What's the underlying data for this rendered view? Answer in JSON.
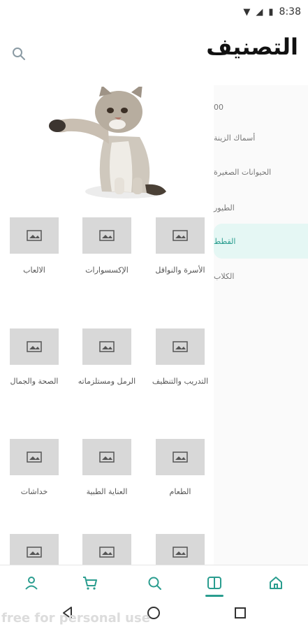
{
  "status_bar": {
    "time": "8:38"
  },
  "header": {
    "title": "التصنيف"
  },
  "sidebar": {
    "items": [
      {
        "label": "00",
        "active": false
      },
      {
        "label": "أسماك الزينة",
        "active": false
      },
      {
        "label": "الحيوانات الصغيرة",
        "active": false
      },
      {
        "label": "الطيور",
        "active": false
      },
      {
        "label": "القطط",
        "active": true
      },
      {
        "label": "الكلاب",
        "active": false
      }
    ]
  },
  "hero": {
    "alt": "kitten"
  },
  "grid": [
    {
      "label": "الأسرة والنواقل"
    },
    {
      "label": "الإكسسوارات"
    },
    {
      "label": "الالعاب"
    },
    {
      "label": "التدريب والتنظيف"
    },
    {
      "label": "الرمل ومستلزماته"
    },
    {
      "label": "الصحة والجمال"
    },
    {
      "label": "الطعام"
    },
    {
      "label": "العناية الطبية"
    },
    {
      "label": "خداشات"
    },
    {
      "label": ""
    },
    {
      "label": ""
    },
    {
      "label": ""
    }
  ],
  "bottom_nav": {
    "items": [
      {
        "icon": "home-icon"
      },
      {
        "icon": "book-icon",
        "active": true
      },
      {
        "icon": "search-icon"
      },
      {
        "icon": "cart-icon"
      },
      {
        "icon": "user-icon"
      }
    ]
  },
  "watermark": "free for personal use",
  "colors": {
    "accent": "#2a9d8f",
    "active_bg": "#e5f7f4",
    "placeholder": "#d8d8d8"
  }
}
